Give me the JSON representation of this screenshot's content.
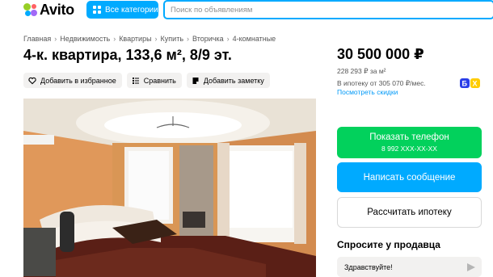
{
  "header": {
    "logo_text": "Avito",
    "categories_label": "Все категории",
    "search_placeholder": "Поиск по объявлениям"
  },
  "breadcrumb": [
    "Главная",
    "Недвижимость",
    "Квартиры",
    "Купить",
    "Вторичка",
    "4-комнатные"
  ],
  "listing": {
    "title": "4-к. квартира, 133,6 м², 8/9 эт.",
    "actions": {
      "favorite": "Добавить в избранное",
      "compare": "Сравнить",
      "note": "Добавить заметку"
    }
  },
  "sidebar": {
    "price": "30 500 000 ₽",
    "price_per_m2": "228 293 ₽ за м²",
    "mortgage_text": "В ипотеку от 305 070 ₽/мес.",
    "mortgage_link": "Посмотреть скидки",
    "phone_button": "Показать телефон",
    "phone_masked": "8 992 XXX-XX-XX",
    "message_button": "Написать сообщение",
    "mortgage_button": "Рассчитать ипотеку",
    "ask_title": "Спросите у продавца",
    "ask_input_value": "Здравствуйте!"
  },
  "colors": {
    "accent_blue": "#00aaff",
    "phone_green": "#02d15c",
    "link_blue": "#0099f7"
  },
  "icons": [
    "grid-icon",
    "heart-icon",
    "compare-icon",
    "note-icon",
    "bank-icon",
    "send-icon"
  ]
}
